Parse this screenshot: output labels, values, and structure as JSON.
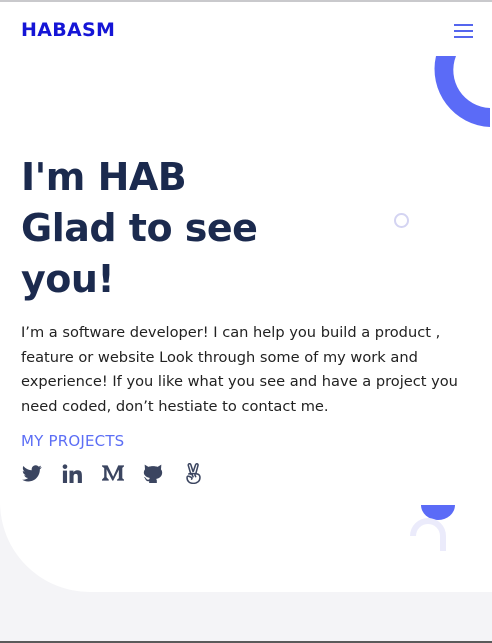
{
  "header": {
    "brand": "HABASM",
    "menu_icon": "hamburger-menu-icon"
  },
  "hero": {
    "headline_lines": [
      "I'm HAB",
      "Glad to see",
      "you!"
    ],
    "bio": "I’m a software developer! I can help you build a product , feature or website Look through some of my work and experience! If you like what you see and have a project you need coded, don’t hestiate to contact me.",
    "projects_link": "MY PROJECTS",
    "social_icons": [
      "twitter-icon",
      "linkedin-icon",
      "medium-icon",
      "github-icon",
      "angellist-icon"
    ]
  },
  "colors": {
    "brand": "#1515d6",
    "heading": "#1b2a4e",
    "accent": "#5c6ef5",
    "icon": "#3b4560",
    "background": "#f4f4f7"
  }
}
